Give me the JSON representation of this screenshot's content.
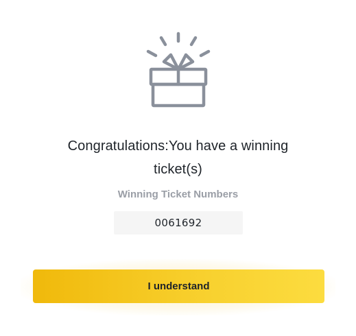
{
  "dialog": {
    "icon": "gift-icon",
    "title_line1": "Congratulations:You have a winning",
    "title_line2": "ticket(s)",
    "subtitle": "Winning Ticket Numbers",
    "ticket_numbers": [
      "0061692"
    ],
    "confirm_label": "I understand"
  },
  "colors": {
    "accent": "#f0b90b",
    "accent_light": "#fcdc3f",
    "title_text": "#1e2329",
    "muted_text": "#9a9ea6",
    "icon_gray": "#8a909b",
    "ticket_bg": "#f5f5f5"
  }
}
